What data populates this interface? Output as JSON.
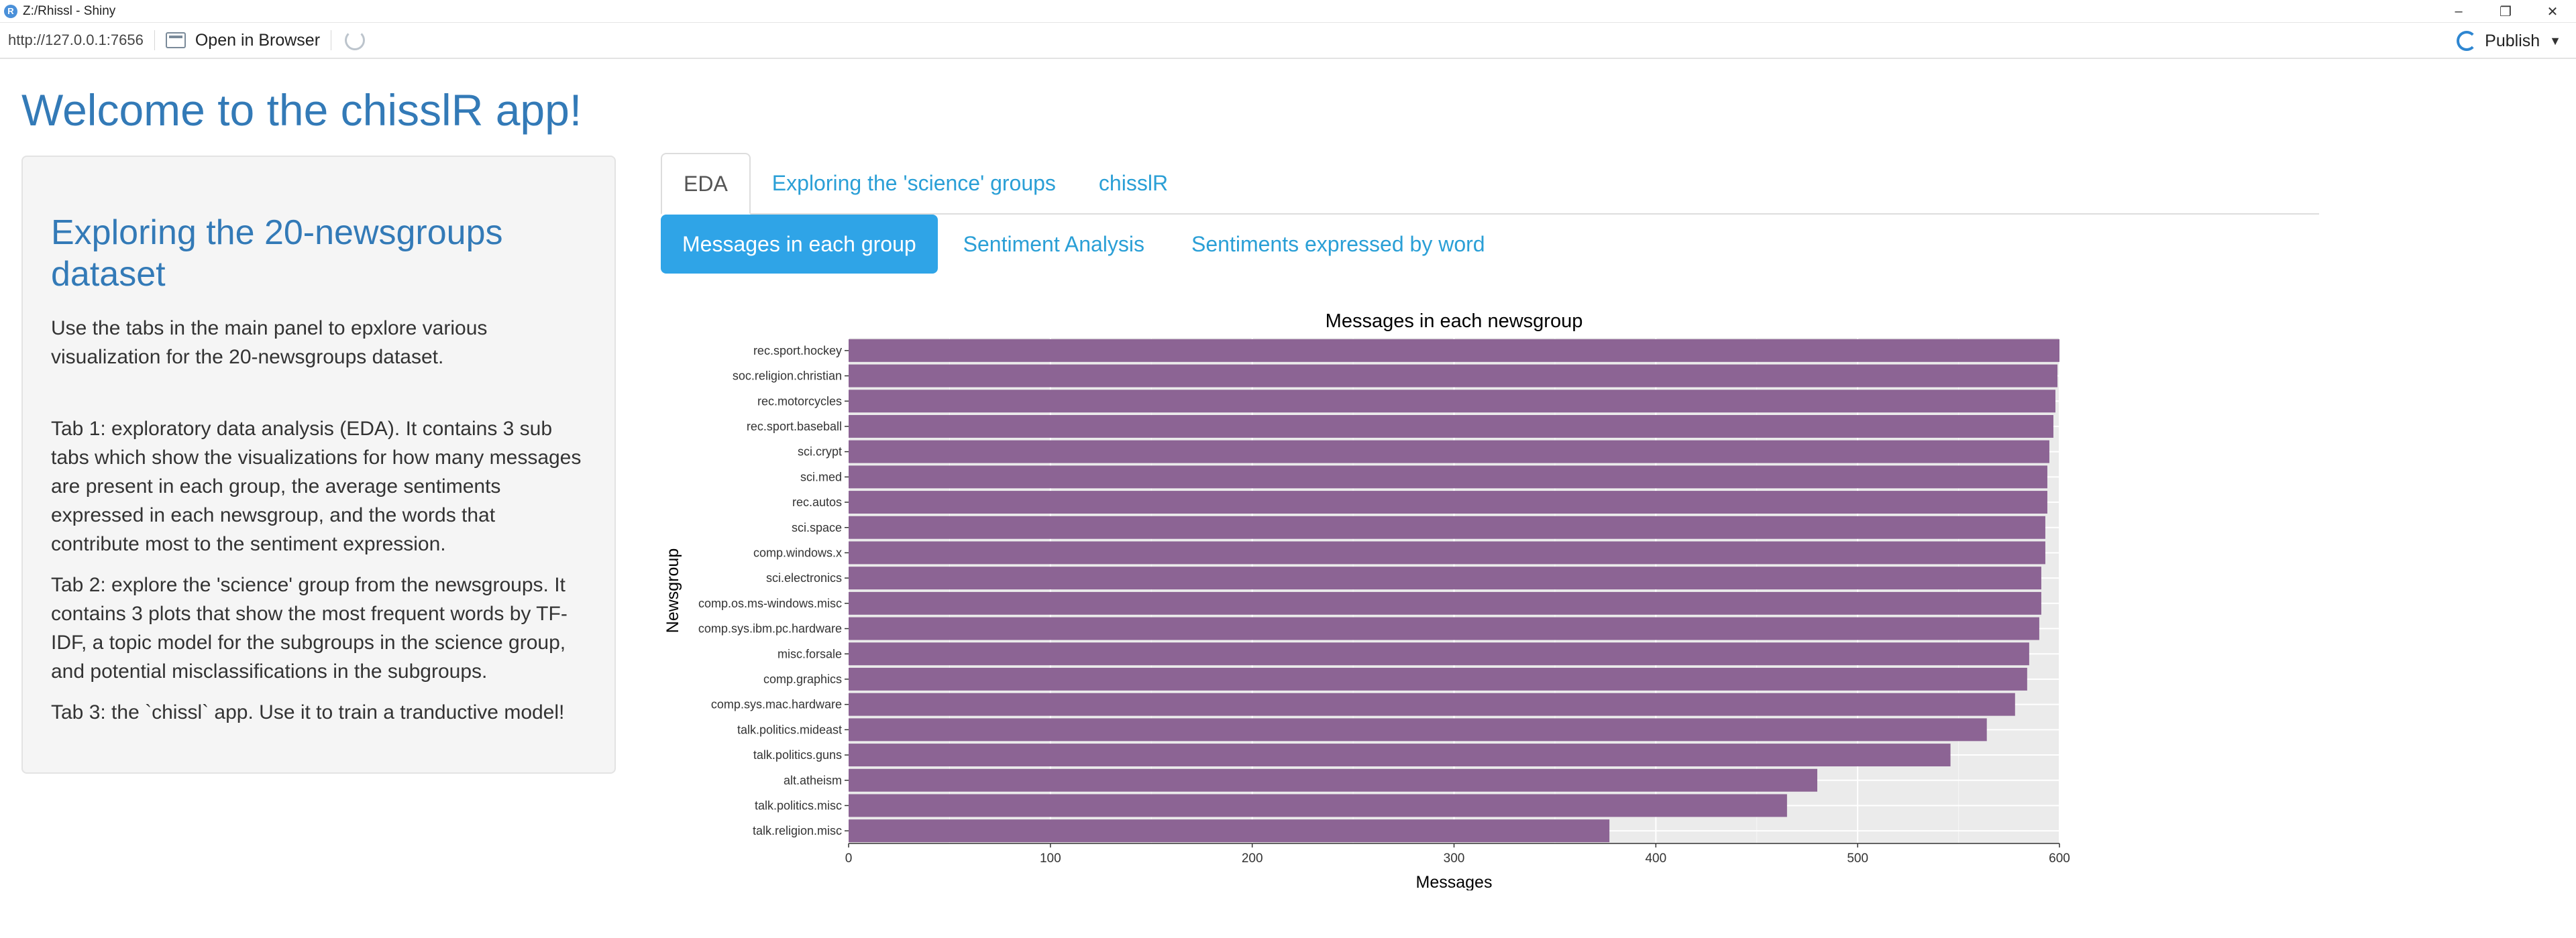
{
  "window": {
    "title": "Z:/Rhissl - Shiny",
    "controls": [
      "–",
      "❐",
      "✕"
    ]
  },
  "toolbar": {
    "url": "http://127.0.0.1:7656",
    "open_in_browser": "Open in Browser",
    "publish": "Publish"
  },
  "page": {
    "title": "Welcome to the chisslR app!"
  },
  "sidebar": {
    "heading": "Exploring the 20-newsgroups dataset",
    "intro": "Use the tabs in the main panel to epxlore various visualization for the 20-newsgroups dataset.",
    "tab1": "Tab 1: exploratory data analysis (EDA). It contains 3 sub tabs which show the visualizations for how many messages are present in each group, the average sentiments expressed in each newsgroup, and the words that contribute most to the sentiment expression.",
    "tab2": "Tab 2: explore the 'science' group from the newsgroups. It contains 3 plots that show the most frequent words by TF-IDF, a topic model for the subgroups in the science group, and potential misclassifications in the subgroups.",
    "tab3": "Tab 3: the `chissl` app. Use it to train a tranductive model!"
  },
  "tabs": [
    {
      "label": "EDA",
      "active": true
    },
    {
      "label": "Exploring the 'science' groups",
      "active": false
    },
    {
      "label": "chisslR",
      "active": false
    }
  ],
  "subtabs": [
    {
      "label": "Messages in each group",
      "active": true
    },
    {
      "label": "Sentiment Analysis",
      "active": false
    },
    {
      "label": "Sentiments expressed by word",
      "active": false
    }
  ],
  "chart_data": {
    "type": "bar",
    "orientation": "horizontal",
    "title": "Messages in each newsgroup",
    "xlabel": "Messages",
    "ylabel": "Newsgroup",
    "xlim": [
      0,
      600
    ],
    "xticks": [
      0,
      100,
      200,
      300,
      400,
      500,
      600
    ],
    "grid": true,
    "bar_color": "#8c6494",
    "categories": [
      "rec.sport.hockey",
      "soc.religion.christian",
      "rec.motorcycles",
      "rec.sport.baseball",
      "sci.crypt",
      "sci.med",
      "rec.autos",
      "sci.space",
      "comp.windows.x",
      "sci.electronics",
      "comp.os.ms-windows.misc",
      "comp.sys.ibm.pc.hardware",
      "misc.forsale",
      "comp.graphics",
      "comp.sys.mac.hardware",
      "talk.politics.mideast",
      "talk.politics.guns",
      "alt.atheism",
      "talk.politics.misc",
      "talk.religion.misc"
    ],
    "values": [
      600,
      599,
      598,
      597,
      595,
      594,
      594,
      593,
      593,
      591,
      591,
      590,
      585,
      584,
      578,
      564,
      546,
      480,
      465,
      377
    ]
  }
}
